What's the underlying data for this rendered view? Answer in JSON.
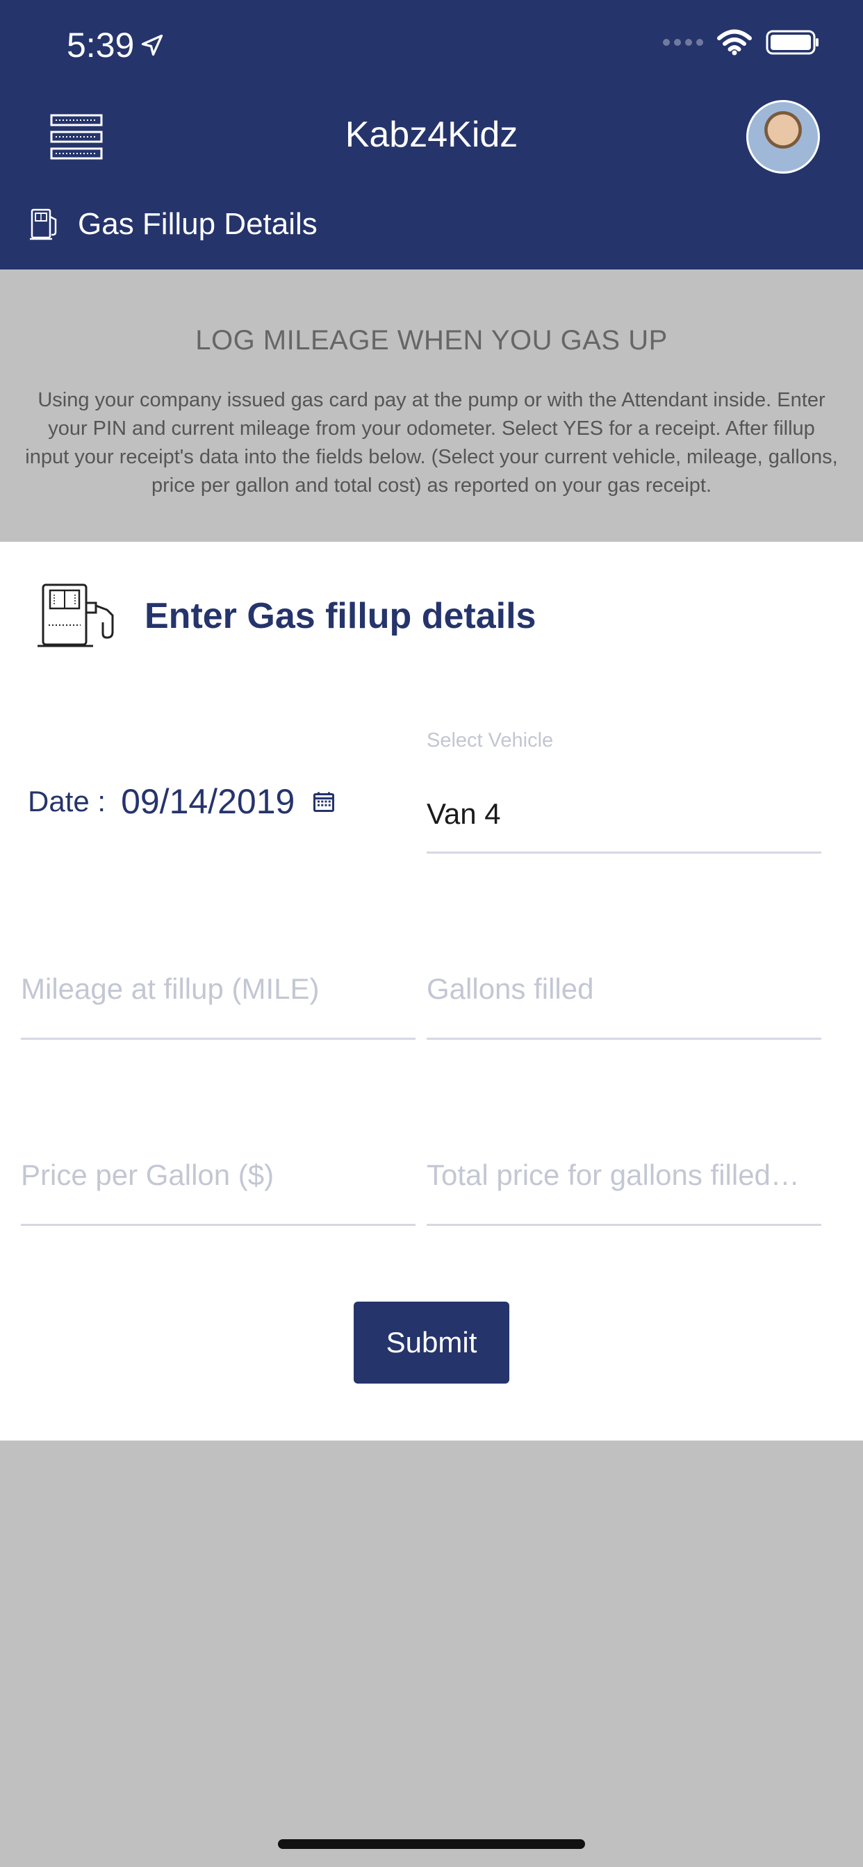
{
  "status_bar": {
    "time": "5:39"
  },
  "header": {
    "app_title": "Kabz4Kidz",
    "page_title": "Gas Fillup Details"
  },
  "banner": {
    "title": "LOG MILEAGE WHEN YOU GAS UP",
    "body": "Using your company issued gas card pay at the pump or with the Attendant inside. Enter your PIN and current mileage from your odometer. Select YES for a receipt. After fillup input your receipt's data into the fields below. (Select your current vehicle, mileage, gallons, price per gallon and total cost) as reported on your gas receipt."
  },
  "form": {
    "title": "Enter Gas fillup details",
    "date_label": "Date :",
    "date_value": "09/14/2019",
    "vehicle_label": "Select Vehicle",
    "vehicle_value": "Van 4",
    "mileage_placeholder": "Mileage at fillup (MILE)",
    "gallons_placeholder": "Gallons filled",
    "price_placeholder": "Price per Gallon ($)",
    "total_placeholder": "Total price for gallons filled…",
    "submit_label": "Submit"
  },
  "colors": {
    "brand": "#25346b",
    "background": "#c0c0c0"
  }
}
